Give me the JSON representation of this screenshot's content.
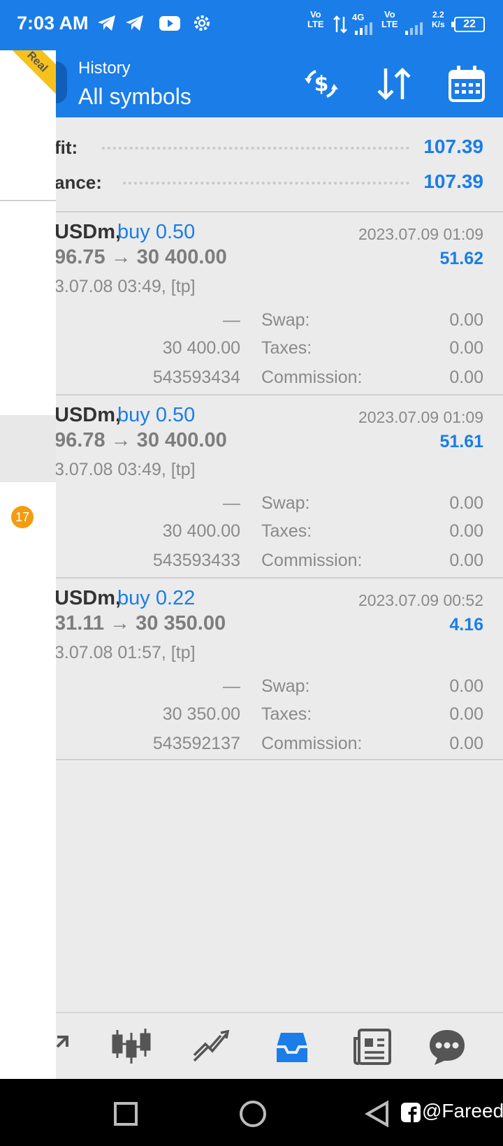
{
  "status_bar": {
    "time": "7:03 AM",
    "net1": "Vo\nLTE",
    "net2": "Vo\nLTE",
    "net_gen": "4G",
    "speed": "2.2\nK/s",
    "battery": "22",
    "icons": [
      "telegram-icon",
      "telegram-icon",
      "youtube-icon",
      "settings-gear-icon"
    ]
  },
  "header": {
    "subtitle": "History",
    "title": "All symbols",
    "actions": [
      "currency-exchange-icon",
      "sort-icon",
      "calendar-icon"
    ]
  },
  "drawer": {
    "ribbon_label": "Real",
    "badge_count": "17"
  },
  "summary": {
    "profit_label": "fit:",
    "profit_value": "107.39",
    "balance_label": "ance:",
    "balance_value": "107.39"
  },
  "trades": [
    {
      "symbol": "USDm,",
      "side": "buy 0.50",
      "open_date": "2023.07.09 01:09",
      "prices": "96.75 → 30 400.00",
      "profit": "51.62",
      "close_info": "3.07.08 03:49, [tp]",
      "sl": "—",
      "tp": "30 400.00",
      "ticket": "543593434",
      "swap_label": "Swap:",
      "swap": "0.00",
      "taxes_label": "Taxes:",
      "taxes": "0.00",
      "commission_label": "Commission:",
      "commission": "0.00"
    },
    {
      "symbol": "USDm,",
      "side": "buy 0.50",
      "open_date": "2023.07.09 01:09",
      "prices": "96.78 → 30 400.00",
      "profit": "51.61",
      "close_info": "3.07.08 03:49, [tp]",
      "sl": "—",
      "tp": "30 400.00",
      "ticket": "543593433",
      "swap_label": "Swap:",
      "swap": "0.00",
      "taxes_label": "Taxes:",
      "taxes": "0.00",
      "commission_label": "Commission:",
      "commission": "0.00"
    },
    {
      "symbol": "USDm,",
      "side": "buy 0.22",
      "open_date": "2023.07.09 00:52",
      "prices": "31.11 → 30 350.00",
      "profit": "4.16",
      "close_info": "3.07.08 01:57, [tp]",
      "sl": "—",
      "tp": "30 350.00",
      "ticket": "543592137",
      "swap_label": "Swap:",
      "swap": "0.00",
      "taxes_label": "Taxes:",
      "taxes": "0.00",
      "commission_label": "Commission:",
      "commission": "0.00"
    }
  ],
  "bottom_nav": [
    "quotes-icon",
    "chart-candles-icon",
    "trade-icon",
    "history-icon",
    "news-icon",
    "chat-icon"
  ],
  "watermark": "@Fareed",
  "colors": {
    "accent": "#1a7de8",
    "background": "#ebebeb",
    "badge": "#f39c12",
    "ribbon": "#f5c11a"
  }
}
